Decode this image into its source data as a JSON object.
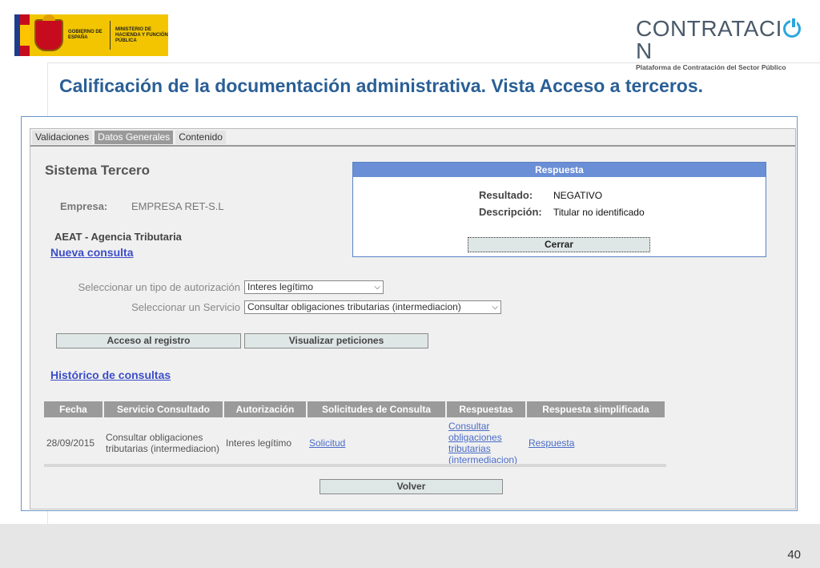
{
  "header": {
    "gov_left": "GOBIERNO DE ESPAÑA",
    "gov_right": "MINISTERIO DE HACIENDA Y FUNCIÓN PÚBLICA",
    "brand_a": "CONTRATACI",
    "brand_b": "N",
    "brand_sub": "Plataforma de Contratación del Sector Público"
  },
  "slide_title": "Calificación de la documentación administrativa. Vista Acceso a terceros.",
  "tabs": [
    {
      "label": "Validaciones"
    },
    {
      "label": "Datos Generales",
      "active": true
    },
    {
      "label": "Contenido"
    }
  ],
  "main": {
    "title": "Sistema Tercero",
    "empresa_label": "Empresa:",
    "empresa_value": "EMPRESA RET-S.L",
    "agency": "AEAT - Agencia Tributaria",
    "nueva_consulta": "Nueva consulta",
    "auth_label": "Seleccionar un tipo de autorización",
    "auth_value": "Interes legítimo",
    "service_label": "Seleccionar un Servicio",
    "service_value": "Consultar obligaciones tributarias (intermediacion)",
    "btn_registro": "Acceso al registro",
    "btn_peticiones": "Visualizar peticiones",
    "historico": "Histórico de consultas",
    "btn_volver": "Volver"
  },
  "table": {
    "headers": [
      "Fecha",
      "Servicio Consultado",
      "Autorización",
      "Solicitudes de Consulta",
      "Respuestas",
      "Respuesta simplificada"
    ],
    "rows": [
      {
        "fecha": "28/09/2015",
        "servicio": "Consultar obligaciones tributarias (intermediacion)",
        "autorizacion": "Interes legítimo",
        "solicitud": "Solicitud",
        "respuestas": "Consultar obligaciones tributarias (intermediacion)",
        "simplificada": "Respuesta"
      }
    ]
  },
  "modal": {
    "title": "Respuesta",
    "resultado_label": "Resultado:",
    "resultado_value": "NEGATIVO",
    "descripcion_label": "Descripción:",
    "descripcion_value": "Titular no identificado",
    "close": "Cerrar"
  },
  "footer": {
    "page_number": "40"
  }
}
